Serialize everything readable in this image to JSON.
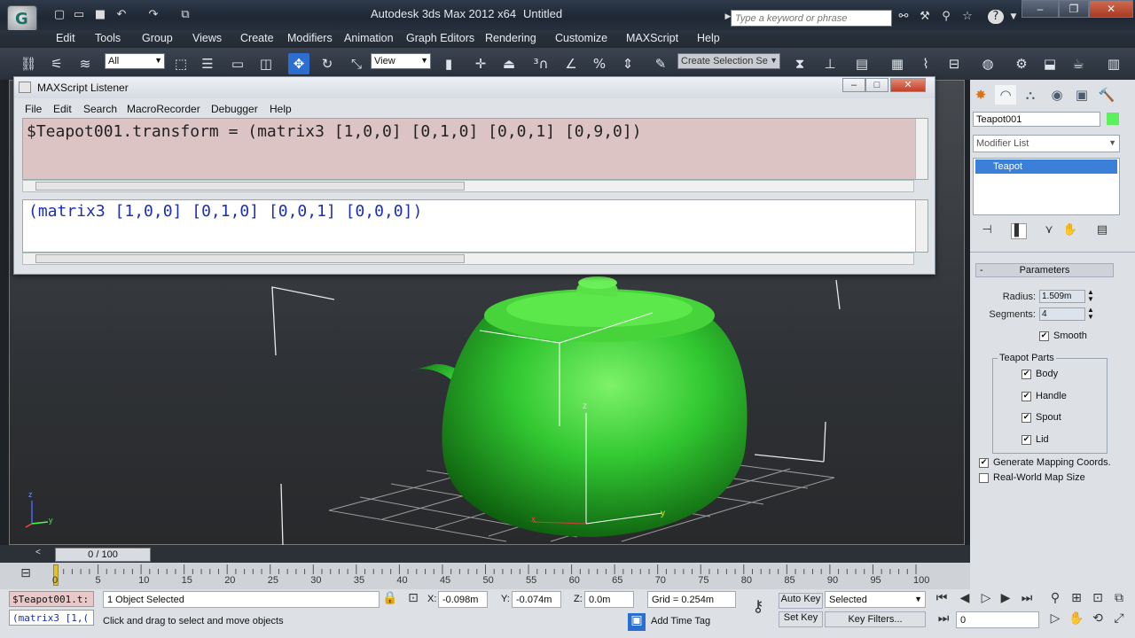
{
  "title": {
    "app": "Autodesk 3ds Max  2012 x64",
    "doc": "Untitled",
    "search_placeholder": "Type a keyword or phrase",
    "logo": "G"
  },
  "menubar": [
    "Edit",
    "Tools",
    "Group",
    "Views",
    "Create",
    "Modifiers",
    "Animation",
    "Graph Editors",
    "Rendering",
    "Customize",
    "MAXScript",
    "Help"
  ],
  "toolbar": {
    "filter": "All",
    "refcoord": "View",
    "selection_set": "Create Selection Se"
  },
  "listener": {
    "title": "MAXScript Listener",
    "menu": [
      "File",
      "Edit",
      "Search",
      "MacroRecorder",
      "Debugger",
      "Help"
    ],
    "input": "$Teapot001.transform = (matrix3 [1,0,0] [0,1,0] [0,0,1] [0,9,0])",
    "output": "(matrix3 [1,0,0] [0,1,0] [0,0,1] [0,0,0])"
  },
  "viewport": {
    "axis_z": "z",
    "axis_x": "x",
    "axis_y": "y"
  },
  "panel": {
    "object_name": "Teapot001",
    "object_color": "#5cf05c",
    "modifier_list": "Modifier List",
    "stack_item": "Teapot",
    "rollout": "Parameters",
    "radius_label": "Radius:",
    "radius_value": "1.509m",
    "segments_label": "Segments:",
    "segments_value": "4",
    "smooth": "Smooth",
    "parts_title": "Teapot Parts",
    "parts": [
      "Body",
      "Handle",
      "Spout",
      "Lid"
    ],
    "gen_map": "Generate Mapping Coords.",
    "real_world": "Real-World Map Size"
  },
  "timeline": {
    "slider": "0 / 100",
    "ticks": [
      "0",
      "5",
      "10",
      "15",
      "20",
      "25",
      "30",
      "35",
      "40",
      "45",
      "50",
      "55",
      "60",
      "65",
      "70",
      "75",
      "80",
      "85",
      "90",
      "95",
      "100"
    ]
  },
  "status": {
    "mini_listener_1": "$Teapot001.t:",
    "mini_listener_2": "(matrix3 [1,(",
    "selected": "1 Object Selected",
    "prompt": "Click and drag to select and move objects",
    "x_label": "X:",
    "x_value": "-0.098m",
    "y_label": "Y:",
    "y_value": "-0.074m",
    "z_label": "Z:",
    "z_value": "0.0m",
    "grid": "Grid = 0.254m",
    "add_time_tag": "Add Time Tag",
    "auto_key": "Auto Key",
    "set_key": "Set Key",
    "key_mode": "Selected",
    "key_filters": "Key Filters...",
    "frame": "0"
  }
}
